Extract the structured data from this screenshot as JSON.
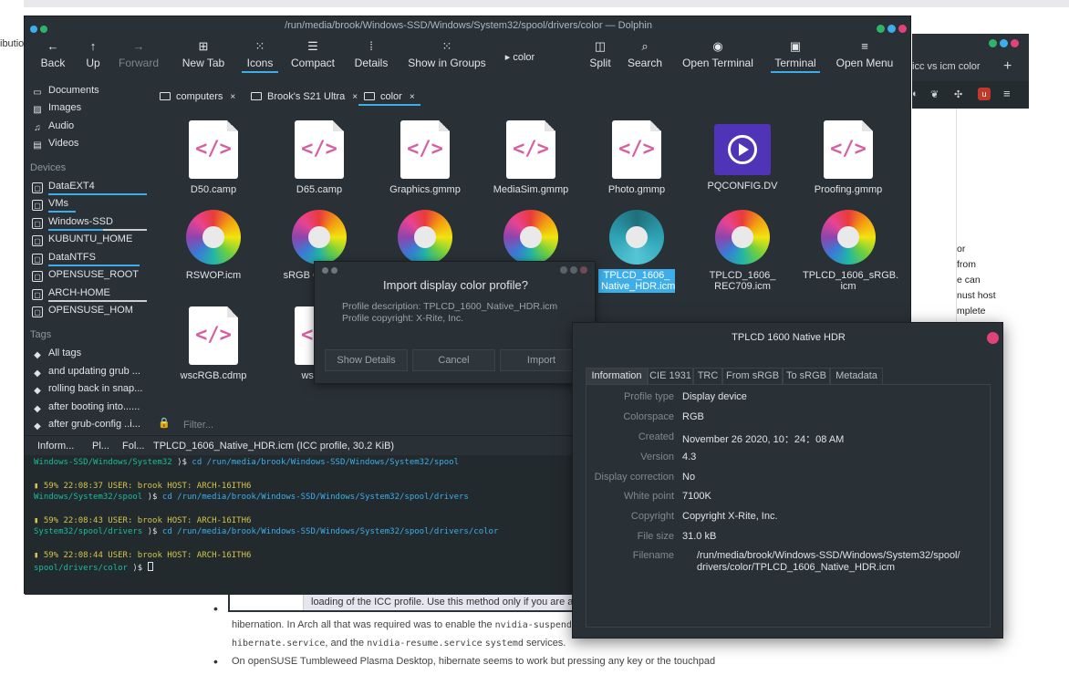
{
  "background": {
    "side_text": "ibutio",
    "list": {
      "line1_text": "hibernation. In Arch all that was required was to enable the",
      "line1_code": "nvidia-suspend.servi",
      "line2_code1": "hibernate.service",
      "line2_text": ", and the",
      "line2_code2": "nvidia-resume.service",
      "line2_code3": "systemd",
      "line2_end": "services.",
      "line3_text": "On openSUSE Tumbleweed Plasma Desktop, hibernate seems to work but pressing any key or the touchpad",
      "bullet": "•"
    }
  },
  "browser_behind": {
    "tab_title": "icc vs icm color",
    "plus": "+",
    "snippets": [
      "or",
      "from",
      "e can",
      "nust host",
      "mplete"
    ],
    "highlight_text": "loading of the ICC profile. Use this method only if you are a"
  },
  "dolphin": {
    "title": "/run/media/brook/Windows-SSD/Windows/System32/spool/drivers/color — Dolphin",
    "toolbar": [
      {
        "icon": "←",
        "label": "Back"
      },
      {
        "icon": "↑",
        "label": "Up"
      },
      {
        "icon": "→",
        "label": "Forward"
      },
      {
        "icon": "⊞",
        "label": "New Tab"
      },
      {
        "icon": "⁙",
        "label": "Icons"
      },
      {
        "icon": "☰",
        "label": "Compact"
      },
      {
        "icon": "⁞",
        "label": "Details"
      },
      {
        "icon": "⁙",
        "label": "Show in Groups"
      },
      {
        "icon": "▸",
        "label": "color"
      },
      {
        "icon": "◫",
        "label": "Split"
      },
      {
        "icon": "⌕",
        "label": "Search"
      },
      {
        "icon": "◉",
        "label": "Open Terminal"
      },
      {
        "icon": "▣",
        "label": "Terminal"
      },
      {
        "icon": "≡",
        "label": "Open Menu"
      }
    ],
    "places": {
      "items": [
        {
          "label": "Documents",
          "icon": "▭"
        },
        {
          "label": "Images",
          "icon": "▨"
        },
        {
          "label": "Audio",
          "icon": "♫"
        },
        {
          "label": "Videos",
          "icon": "▤"
        }
      ],
      "devices_header": "Devices",
      "devices": [
        {
          "label": "DataEXT4"
        },
        {
          "label": "VMs"
        },
        {
          "label": "Windows-SSD"
        },
        {
          "label": "KUBUNTU_HOME"
        },
        {
          "label": "DataNTFS"
        },
        {
          "label": "OPENSUSE_ROOT"
        },
        {
          "label": "ARCH-HOME"
        },
        {
          "label": "OPENSUSE_HOM"
        }
      ],
      "tags_header": "Tags",
      "tags": [
        {
          "label": "All tags"
        },
        {
          "label": "and updating grub ..."
        },
        {
          "label": "rolling back in snap..."
        },
        {
          "label": "after booting into......"
        },
        {
          "label": "after grub-config ..i..."
        }
      ]
    },
    "view_tabs": [
      {
        "label": "computers",
        "close": "×"
      },
      {
        "label": "Brook's S21 Ultra",
        "close": "×"
      },
      {
        "label": "color",
        "close": "×"
      }
    ],
    "files_row1": [
      {
        "name": "D50.camp"
      },
      {
        "name": "D65.camp"
      },
      {
        "name": "Graphics.gmmp"
      },
      {
        "name": "MediaSim.gmmp"
      },
      {
        "name": "Photo.gmmp"
      },
      {
        "name": "PQCONFIG.DV"
      },
      {
        "name": "Proofing.gmmp"
      }
    ],
    "files_row2": [
      {
        "name": "RSWOP.icm"
      },
      {
        "name": "sRGB Co... Prof"
      },
      {
        "name": ""
      },
      {
        "name": ""
      },
      {
        "name": "TPLCD_1606_ Native_HDR.icm"
      },
      {
        "name": "TPLCD_1606_ REC709.icm"
      },
      {
        "name": "TPLCD_1606_sRGB. icm"
      }
    ],
    "files_row3": [
      {
        "name": "wscRGB.cdmp"
      },
      {
        "name": "wsRG..."
      }
    ],
    "doc_glyph": "</>",
    "filter_placeholder": "Filter...",
    "filter_lock": "🔒",
    "status": {
      "tab1": "Inform...",
      "tab2": "Pl...",
      "tab3": "Fol...",
      "selection": "TPLCD_1606_Native_HDR.icm (ICC profile, 30.2 KiB)"
    },
    "terminal": {
      "lines": [
        {
          "dir": "Windows-SSD/Windows/System32",
          "prompt": " ⟩$ ",
          "cmd": "cd /run/media/brook/Windows-SSD/Windows/System32/spool"
        },
        {
          "status": "▮ 59%  22:08:37  USER: brook  HOST: ARCH-16ITH6"
        },
        {
          "dir": "Windows/System32/spool",
          "prompt": " ⟩$ ",
          "cmd": "cd /run/media/brook/Windows-SSD/Windows/System32/spool/drivers"
        },
        {
          "status": "▮ 59%  22:08:43  USER: brook  HOST: ARCH-16ITH6"
        },
        {
          "dir": "System32/spool/drivers",
          "prompt": " ⟩$ ",
          "cmd": "cd /run/media/brook/Windows-SSD/Windows/System32/spool/drivers/color"
        },
        {
          "status": "▮ 59%  22:08:44  USER: brook  HOST: ARCH-16ITH6"
        },
        {
          "dir": "spool/drivers/color",
          "prompt": " ⟩$ ",
          "cmd": ""
        }
      ]
    }
  },
  "dialog": {
    "title": "Import display color profile?",
    "description": "Profile description: TPLCD_1600_Native_HDR.icm",
    "copyright": "Profile copyright: X-Rite, Inc.",
    "buttons": [
      "Show Details",
      "Cancel",
      "Import"
    ]
  },
  "viewer": {
    "title": "TPLCD 1600 Native HDR",
    "tabs": [
      "Information",
      "CIE 1931",
      "TRC",
      "From sRGB",
      "To sRGB",
      "Metadata"
    ],
    "rows": [
      {
        "key": "Profile type",
        "value": "Display device"
      },
      {
        "key": "Colorspace",
        "value": "RGB"
      },
      {
        "key": "Created",
        "value": "November 26 2020, 10：24：08 AM"
      },
      {
        "key": "Version",
        "value": "4.3"
      },
      {
        "key": "Display correction",
        "value": "No"
      },
      {
        "key": "White point",
        "value": "7100K"
      },
      {
        "key": "Copyright",
        "value": "Copyright X-Rite, Inc."
      },
      {
        "key": "File size",
        "value": "31.0 kB"
      },
      {
        "key": "Filename",
        "value": "/run/media/brook/Windows-SSD/Windows/System32/spool/"
      },
      {
        "key": "",
        "value": "drivers/color/TPLCD_1606_Native_HDR.icm"
      }
    ]
  },
  "colors": {
    "accent": "#3daee9",
    "close": "#e0427a",
    "window": "#2a3136"
  }
}
